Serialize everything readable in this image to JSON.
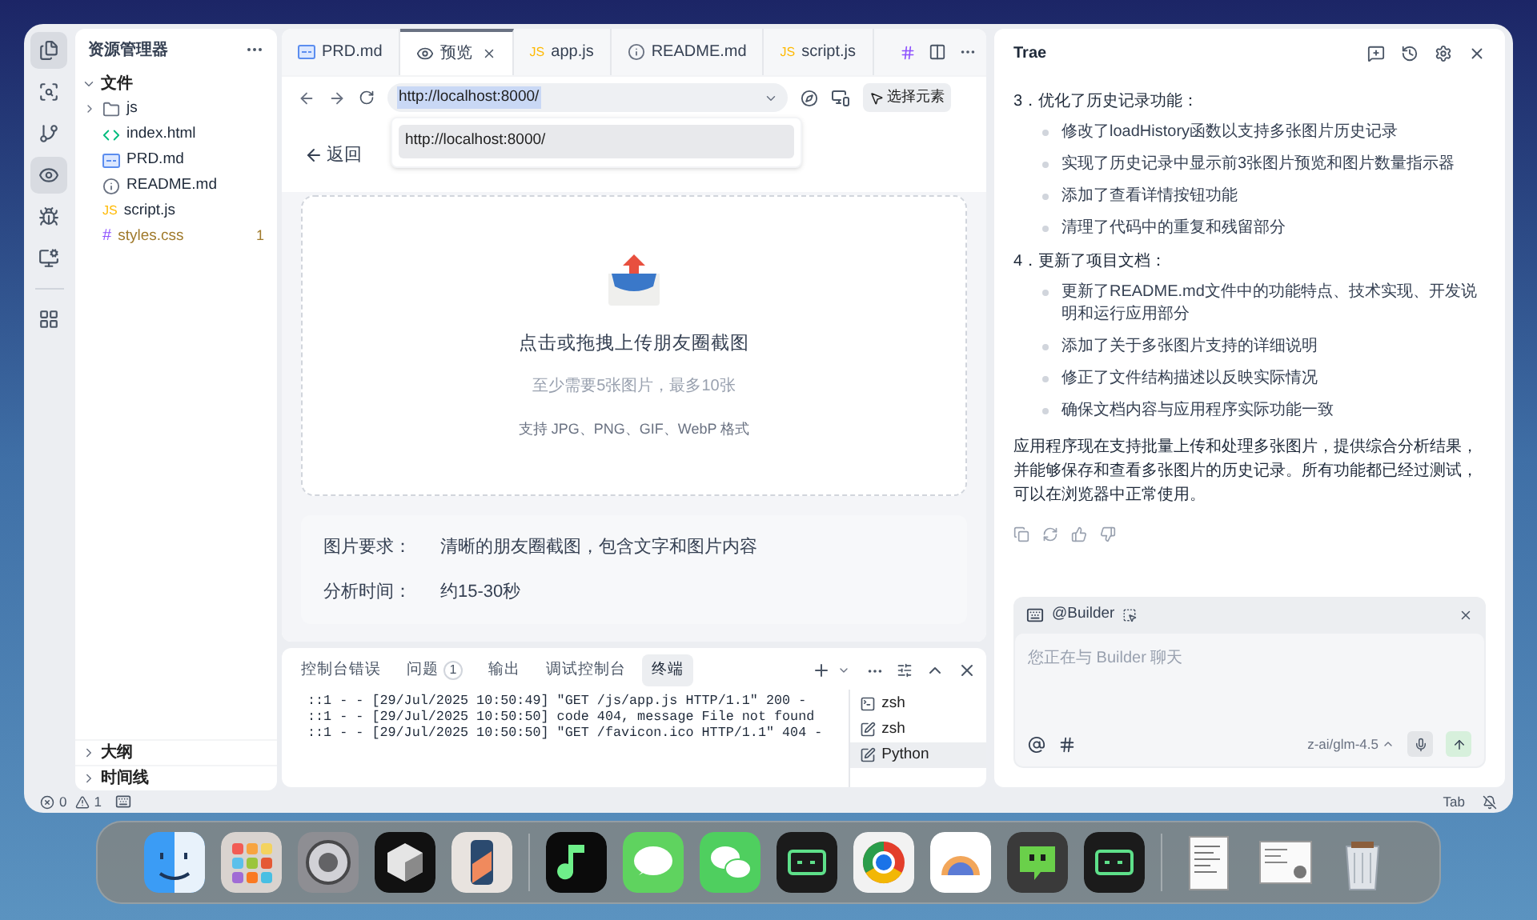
{
  "activity_bar": [
    {
      "kind": "files",
      "selected": true
    },
    {
      "kind": "search",
      "selected": false
    },
    {
      "kind": "git",
      "selected": false
    },
    {
      "kind": "preview",
      "selected": true
    },
    {
      "kind": "debug",
      "selected": false
    },
    {
      "kind": "remote",
      "selected": false
    },
    {
      "kind": "extensions",
      "selected": false
    }
  ],
  "explorer": {
    "title": "资源管理器",
    "section": "文件",
    "expanded": true,
    "files": [
      {
        "name": "js",
        "kind": "folder",
        "modified": false
      },
      {
        "name": "index.html",
        "kind": "html",
        "modified": false
      },
      {
        "name": "PRD.md",
        "kind": "md",
        "modified": false
      },
      {
        "name": "README.md",
        "kind": "info",
        "modified": false
      },
      {
        "name": "script.js",
        "kind": "code",
        "icon": "JS",
        "modified": false
      },
      {
        "name": "styles.css",
        "kind": "style",
        "icon": "#",
        "badge": "1",
        "modified": true
      }
    ],
    "bottom_sections": [
      "大纲",
      "时间线"
    ]
  },
  "tabs": [
    {
      "label": "PRD.md",
      "kind": "md",
      "selected": false
    },
    {
      "label": "预览",
      "kind": "preview",
      "selected": true
    },
    {
      "label": "app.js",
      "kind": "code",
      "icon": "JS",
      "selected": false
    },
    {
      "label": "README.md",
      "kind": "info",
      "selected": false
    },
    {
      "label": "script.js",
      "kind": "code",
      "icon": "JS",
      "selected": false
    }
  ],
  "browser": {
    "url": "http://localhost:8000/",
    "select_element": "选择元素",
    "suggestion": "http://localhost:8000/"
  },
  "page": {
    "back": "返回",
    "upload": {
      "title": "点击或拖拽上传朋友圈截图",
      "subtitle": "至少需要5张图片，最多10张",
      "formats": "支持 JPG、PNG、GIF、WebP 格式"
    },
    "requirements": [
      {
        "label": "图片要求：",
        "value": "清晰的朋友圈截图，包含文字和图片内容"
      },
      {
        "label": "分析时间：",
        "value": "约15-30秒"
      }
    ]
  },
  "panel": {
    "tabs": [
      {
        "label": "控制台错误",
        "selected": false
      },
      {
        "label": "问题",
        "badge": "1",
        "selected": false
      },
      {
        "label": "输出",
        "selected": false
      },
      {
        "label": "调试控制台",
        "selected": false
      },
      {
        "label": "终端",
        "selected": true
      }
    ],
    "terminal_lines": [
      "::1 - - [29/Jul/2025 10:50:49] \"GET /js/app.js HTTP/1.1\" 200 -",
      "::1 - - [29/Jul/2025 10:50:50] code 404, message File not found",
      "::1 - - [29/Jul/2025 10:50:50] \"GET /favicon.ico HTTP/1.1\" 404 -"
    ],
    "terminals": [
      {
        "name": "zsh",
        "kind": "shell",
        "selected": false
      },
      {
        "name": "zsh",
        "kind": "task",
        "selected": false
      },
      {
        "name": "Python",
        "kind": "task",
        "selected": true
      }
    ]
  },
  "chat": {
    "title": "Trae",
    "sections": [
      {
        "heading": "3．优化了历史记录功能：",
        "items": [
          "修改了loadHistory函数以支持多张图片历史记录",
          "实现了历史记录中显示前3张图片预览和图片数量指示器",
          "添加了查看详情按钮功能",
          "清理了代码中的重复和残留部分"
        ]
      },
      {
        "heading": "4．更新了项目文档：",
        "items": [
          "更新了README.md文件中的功能特点、技术实现、开发说明和运行应用部分",
          "添加了关于多张图片支持的详细说明",
          "修正了文件结构描述以反映实际情况",
          "确保文档内容与应用程序实际功能一致"
        ]
      }
    ],
    "summary": "应用程序现在支持批量上传和处理多张图片，提供综合分析结果，并能够保存和查看多张图片的历史记录。所有功能都已经过测试，可以在浏览器中正常使用。",
    "composer": {
      "agent": "@Builder",
      "placeholder": "您正在与 Builder 聊天",
      "model": "z-ai/glm-4.5"
    }
  },
  "status_bar": {
    "errors": "0",
    "warnings": "1",
    "right": "Tab"
  }
}
